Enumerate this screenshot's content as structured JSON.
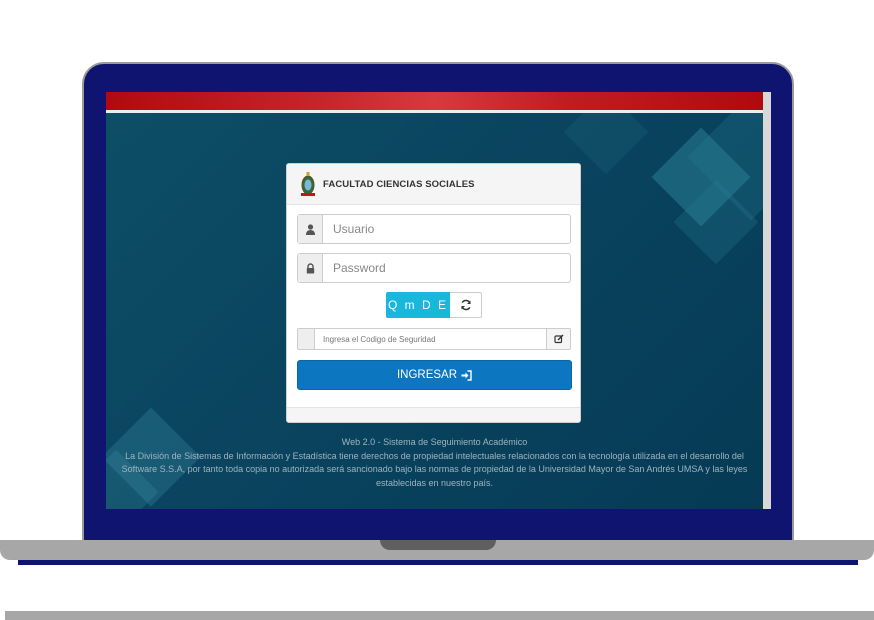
{
  "header": {
    "institution_title": "FACULTAD CIENCIAS SOCIALES",
    "crest_icon": "bolivia-coat-of-arms-icon"
  },
  "login": {
    "username": {
      "placeholder": "Usuario",
      "icon": "user-icon"
    },
    "password": {
      "placeholder": "Password",
      "icon": "lock-icon"
    },
    "captcha": {
      "text": "Q m D E",
      "refresh_icon": "refresh-icon"
    },
    "security_code": {
      "placeholder": "Ingresa el Codigo de Seguridad",
      "icon": "edit-icon"
    },
    "submit": {
      "label": "INGRESAR",
      "icon": "sign-in-icon"
    }
  },
  "footer": {
    "line1": "Web 2.0 - Sistema de Seguimiento Académico",
    "line2": "La División de Sistemas de Información y Estadística tiene derechos de propiedad intelectuales relacionados con la tecnología utilizada en el desarrollo del Software S.S.A, por tanto toda copia no autorizada será sancionado bajo las normas de propiedad de la Universidad Mayor de San Andrés UMSA y las leyes establecidas en nuestro país."
  },
  "colors": {
    "top_bar": "#c0171d",
    "primary_button": "#0c77c0",
    "captcha_bg": "#1ab7dd",
    "laptop_frame": "#0e1470",
    "screen_bg": "#0a4560"
  }
}
